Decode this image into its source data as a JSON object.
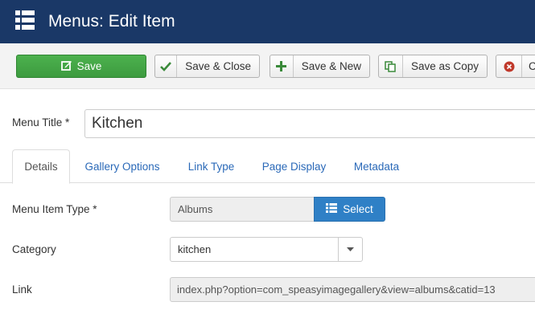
{
  "header": {
    "title": "Menus: Edit Item",
    "icon": "list-icon"
  },
  "toolbar": {
    "save_label": "Save",
    "save_close_label": "Save & Close",
    "save_new_label": "Save & New",
    "save_copy_label": "Save as Copy",
    "close_label": "C",
    "colors": {
      "save_green": "#46a546",
      "close_red": "#c0392b"
    }
  },
  "form": {
    "title_label": "Menu Title *",
    "title_value": "Kitchen",
    "tabs": [
      {
        "label": "Details",
        "active": true
      },
      {
        "label": "Gallery Options",
        "active": false
      },
      {
        "label": "Link Type",
        "active": false
      },
      {
        "label": "Page Display",
        "active": false
      },
      {
        "label": "Metadata",
        "active": false
      }
    ],
    "menu_item_type": {
      "label": "Menu Item Type *",
      "value": "Albums",
      "select_label": "Select"
    },
    "category": {
      "label": "Category",
      "value": "kitchen"
    },
    "link": {
      "label": "Link",
      "value": "index.php?option=com_speasyimagegallery&view=albums&catid=13"
    }
  }
}
